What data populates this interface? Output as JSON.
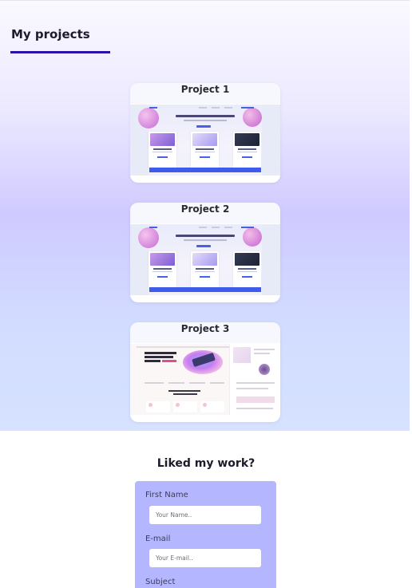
{
  "projects_section": {
    "title": "My projects",
    "projects": [
      {
        "title": "Project 1",
        "preview": "site-thumbnail"
      },
      {
        "title": "Project 2",
        "preview": "site-thumbnail"
      },
      {
        "title": "Project 3",
        "preview": "site-thumbnail"
      }
    ]
  },
  "contact": {
    "title": "Liked my work?",
    "fields": [
      {
        "label": "First Name",
        "placeholder": "Your Name.."
      },
      {
        "label": "E-mail",
        "placeholder": "Your E-mail.."
      },
      {
        "label": "Subject"
      }
    ]
  },
  "colors": {
    "underline": "#2a12a8",
    "form_background": "#b4b7ff",
    "thumbnail_button": "#4760e8"
  }
}
